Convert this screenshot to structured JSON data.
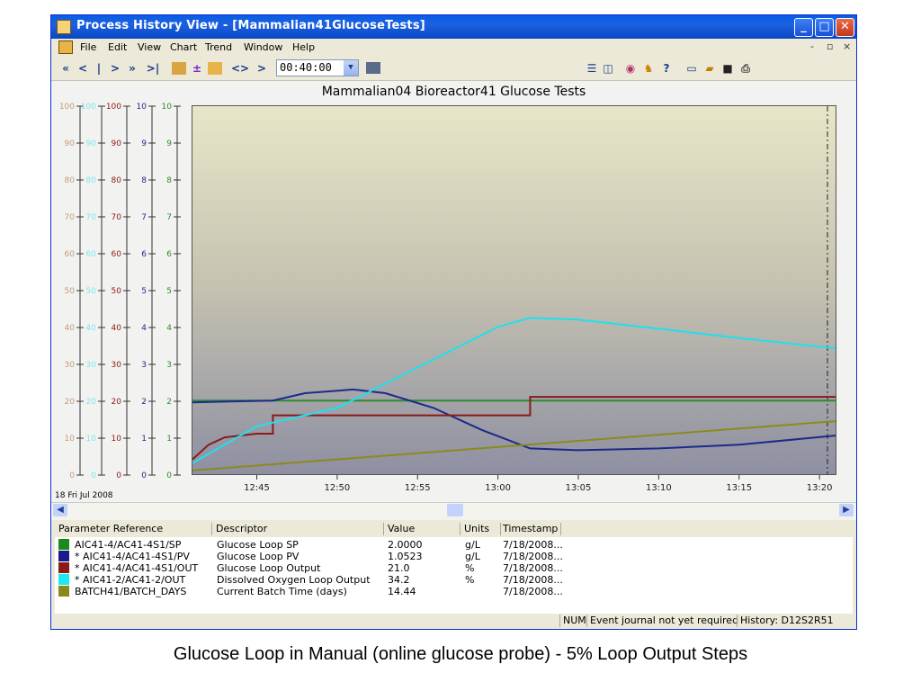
{
  "window": {
    "title": "Process History View - [Mammalian41GlucoseTests]",
    "minimize": "_",
    "maximize": "□",
    "close": "✕"
  },
  "menu": [
    "File",
    "Edit",
    "View",
    "Chart",
    "Trend",
    "Window",
    "Help"
  ],
  "mdi_controls": [
    "-",
    "▫",
    "×"
  ],
  "toolbar": {
    "nav_first": "«",
    "nav_prev": "<",
    "nav_now": "|",
    "nav_next": ">",
    "nav_fast": "»",
    "nav_last": ">|",
    "zoom_out": "<>",
    "zoom_in": "><",
    "time_span": "00:40:00"
  },
  "chart_data": {
    "type": "line",
    "title": "Mammalian04 Bioreactor41 Glucose Tests",
    "date_label": "18 Fri Jul 2008",
    "x_ticks": [
      "12:45",
      "12:50",
      "12:55",
      "13:00",
      "13:05",
      "13:10",
      "13:15",
      "13:20"
    ],
    "xlim": [
      "12:41",
      "13:21"
    ],
    "axes": [
      {
        "color": "#c49a7a",
        "ticks": [
          "0",
          "10",
          "20",
          "30",
          "40",
          "50",
          "60",
          "70",
          "80",
          "90",
          "100"
        ],
        "ylim": [
          0,
          100
        ]
      },
      {
        "color": "#7fe8ee",
        "ticks": [
          "0",
          "10",
          "20",
          "30",
          "40",
          "50",
          "60",
          "70",
          "80",
          "90",
          "100"
        ],
        "ylim": [
          0,
          100
        ]
      },
      {
        "color": "#8b1a1a",
        "ticks": [
          "0",
          "10",
          "20",
          "30",
          "40",
          "50",
          "60",
          "70",
          "80",
          "90",
          "100"
        ],
        "ylim": [
          0,
          100
        ]
      },
      {
        "color": "#1c2a8a",
        "ticks": [
          "0",
          "1",
          "2",
          "3",
          "4",
          "5",
          "6",
          "7",
          "8",
          "9",
          "10"
        ],
        "ylim": [
          0,
          10
        ]
      },
      {
        "color": "#2e8b2e",
        "ticks": [
          "0",
          "1",
          "2",
          "3",
          "4",
          "5",
          "6",
          "7",
          "8",
          "9",
          "10"
        ],
        "ylim": [
          0,
          10
        ]
      }
    ],
    "series": [
      {
        "name": "AIC41-4/AC41-4S1/SP",
        "color": "#2e8b2e",
        "axis": 4,
        "points": [
          [
            "12:41",
            2.0
          ],
          [
            "13:21",
            2.0
          ]
        ]
      },
      {
        "name": "AIC41-4/AC41-4S1/PV",
        "color": "#1c2a8a",
        "axis": 3,
        "points": [
          [
            "12:41",
            1.95
          ],
          [
            "12:46",
            2.0
          ],
          [
            "12:48",
            2.2
          ],
          [
            "12:51",
            2.3
          ],
          [
            "12:53",
            2.2
          ],
          [
            "12:56",
            1.8
          ],
          [
            "12:59",
            1.2
          ],
          [
            "13:02",
            0.7
          ],
          [
            "13:05",
            0.65
          ],
          [
            "13:10",
            0.7
          ],
          [
            "13:15",
            0.8
          ],
          [
            "13:21",
            1.05
          ]
        ]
      },
      {
        "name": "AIC41-4/AC41-4S1/OUT",
        "color": "#8b1a1a",
        "axis": 2,
        "points": [
          [
            "12:41",
            4
          ],
          [
            "12:42",
            8
          ],
          [
            "12:43",
            10
          ],
          [
            "12:45",
            11
          ],
          [
            "12:46",
            11
          ],
          [
            "12:46",
            16
          ],
          [
            "13:02",
            16
          ],
          [
            "13:02",
            21
          ],
          [
            "13:21",
            21
          ]
        ]
      },
      {
        "name": "AIC41-2/AC41-2/OUT",
        "color": "#1ee0f0",
        "axis": 1,
        "points": [
          [
            "12:41",
            3
          ],
          [
            "12:45",
            13
          ],
          [
            "12:50",
            18
          ],
          [
            "12:55",
            29
          ],
          [
            "13:00",
            40
          ],
          [
            "13:02",
            42.5
          ],
          [
            "13:05",
            42
          ],
          [
            "13:10",
            39.5
          ],
          [
            "13:15",
            37
          ],
          [
            "13:21",
            34.2
          ]
        ]
      },
      {
        "name": "BATCH41/BATCH_DAYS",
        "color": "#8b8b1a",
        "axis": 0,
        "points": [
          [
            "12:41",
            1
          ],
          [
            "13:21",
            14.4
          ]
        ]
      }
    ]
  },
  "grid": {
    "headers": [
      "Parameter Reference",
      "Descriptor",
      "Value",
      "Units",
      "Timestamp"
    ],
    "rows": [
      {
        "color": "#1a8a1a",
        "ref": "AIC41-4/AC41-4S1/SP",
        "desc": "Glucose Loop SP",
        "value": "2.0000",
        "units": "g/L",
        "ts": "7/18/2008..."
      },
      {
        "color": "#1a1a8a",
        "ref": "* AIC41-4/AC41-4S1/PV",
        "desc": "Glucose Loop PV",
        "value": "1.0523",
        "units": "g/L",
        "ts": "7/18/2008..."
      },
      {
        "color": "#8a1a1a",
        "ref": "* AIC41-4/AC41-4S1/OUT",
        "desc": "Glucose Loop Output",
        "value": "21.0",
        "units": "%",
        "ts": "7/18/2008..."
      },
      {
        "color": "#1ee8f0",
        "ref": "* AIC41-2/AC41-2/OUT",
        "desc": "Dissolved Oxygen Loop Output",
        "value": "34.2",
        "units": "%",
        "ts": "7/18/2008..."
      },
      {
        "color": "#8a8a1a",
        "ref": "BATCH41/BATCH_DAYS",
        "desc": "Current Batch Time (days)",
        "value": "14.44",
        "units": "",
        "ts": "7/18/2008..."
      }
    ]
  },
  "status": {
    "num": "NUM",
    "journal": "Event journal not yet required",
    "history": "History: D12S2R51"
  },
  "caption": "Glucose Loop in Manual (online glucose probe) - 5% Loop Output Steps"
}
